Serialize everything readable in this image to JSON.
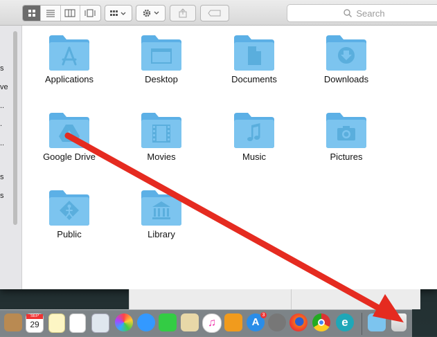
{
  "toolbar": {
    "search_placeholder": "Search"
  },
  "sidebar": {
    "partial_labels": [
      "s",
      "ve",
      "..",
      ".",
      "..",
      "s",
      "s"
    ]
  },
  "folders": [
    {
      "label": "Applications",
      "icon": "app-store-glyph-icon"
    },
    {
      "label": "Desktop",
      "icon": "window-glyph-icon"
    },
    {
      "label": "Documents",
      "icon": "document-glyph-icon"
    },
    {
      "label": "Downloads",
      "icon": "download-glyph-icon"
    },
    {
      "label": "Google Drive",
      "icon": "google-drive-glyph-icon"
    },
    {
      "label": "Movies",
      "icon": "film-glyph-icon"
    },
    {
      "label": "Music",
      "icon": "music-note-glyph-icon"
    },
    {
      "label": "Pictures",
      "icon": "camera-glyph-icon"
    },
    {
      "label": "Public",
      "icon": "public-glyph-icon"
    },
    {
      "label": "Library",
      "icon": "library-glyph-icon"
    }
  ],
  "dock": {
    "calendar_month": "SEP",
    "calendar_day": "29",
    "app_store_badge": "3"
  },
  "colors": {
    "folder": "#7cc4ef",
    "folder_dark": "#5cb0e6",
    "arrow": "#e52b20"
  }
}
